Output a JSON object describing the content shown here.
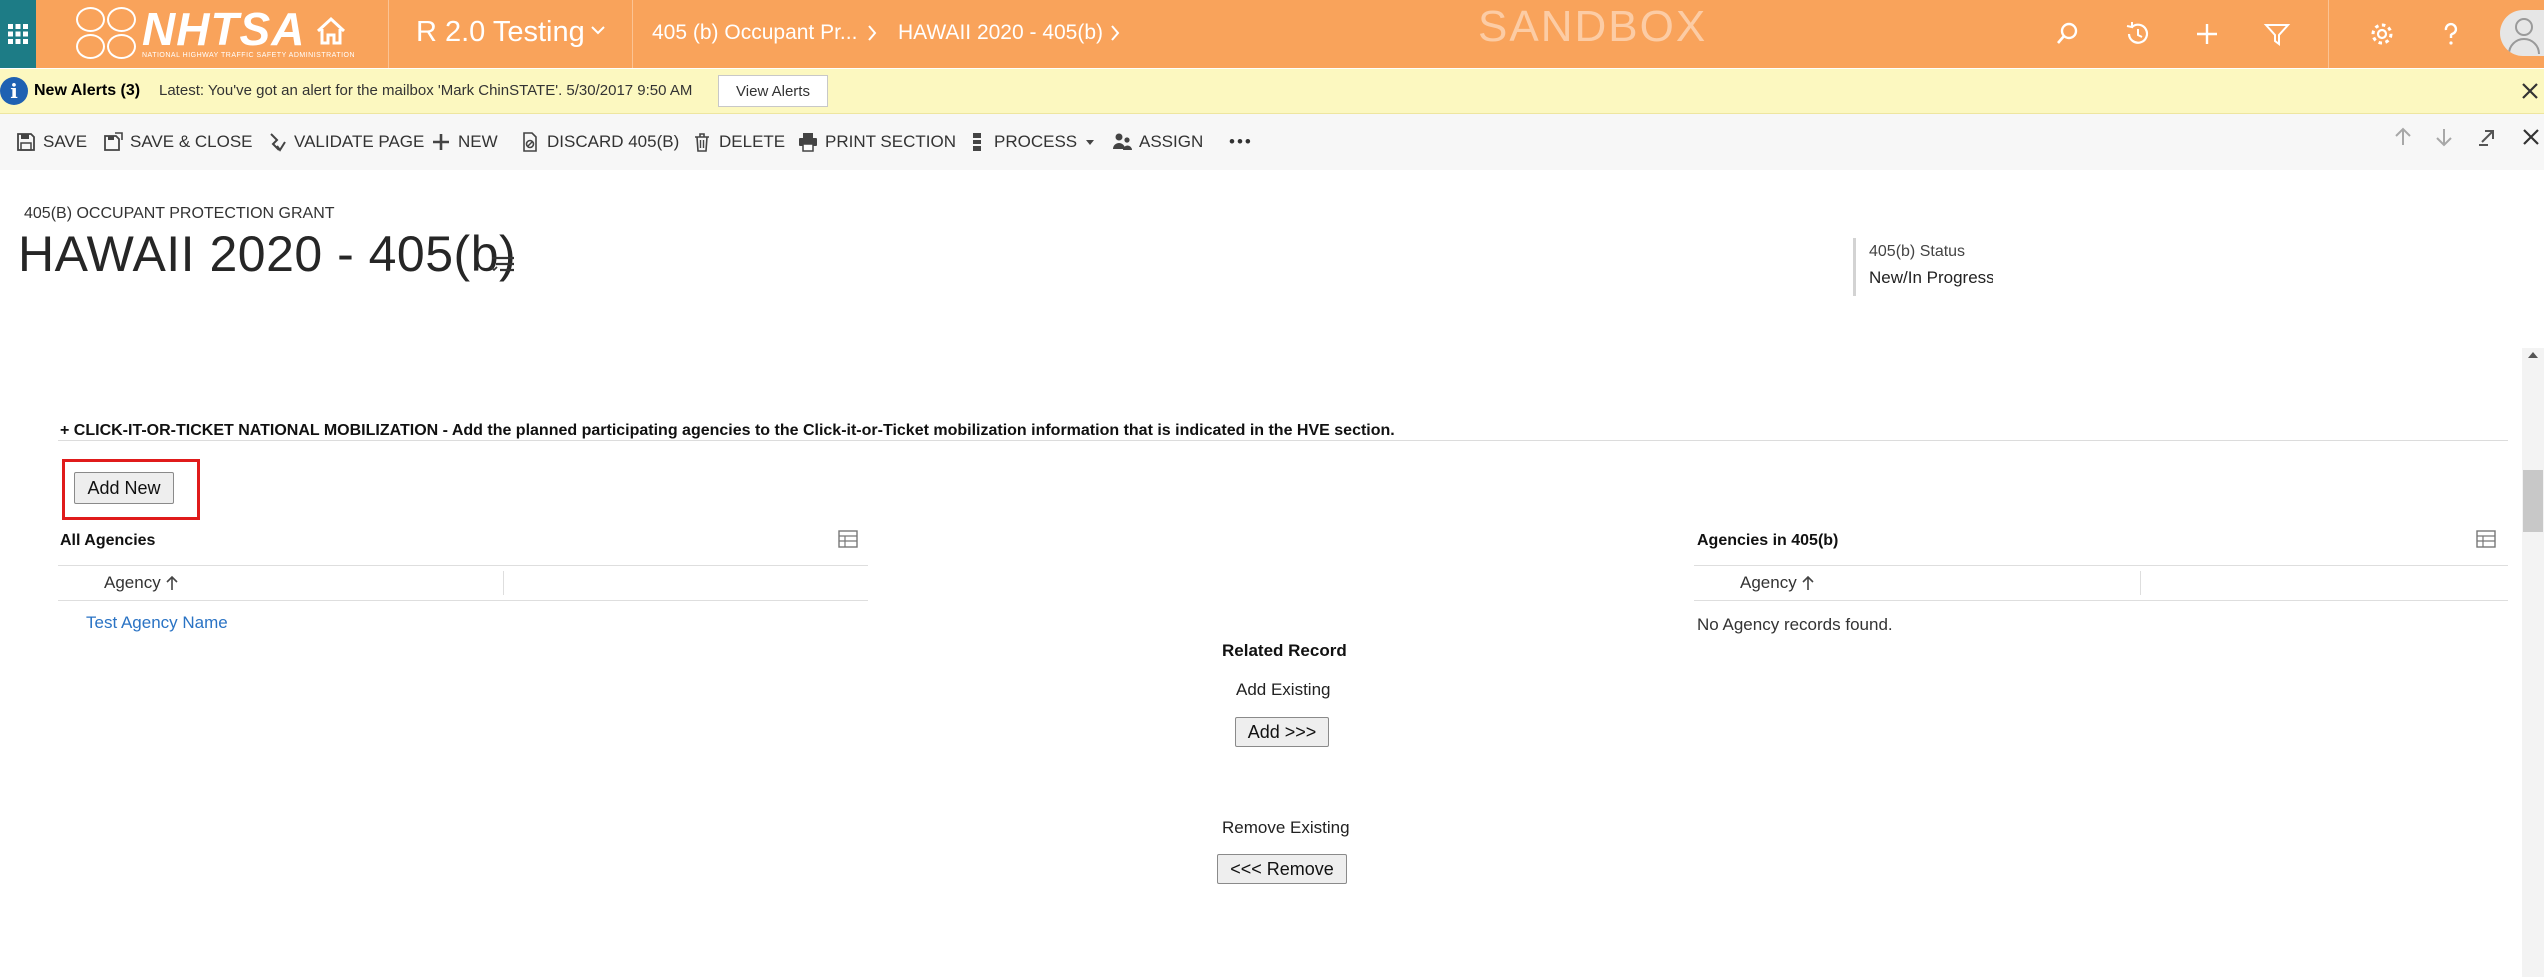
{
  "colors": {
    "topbar_bg": "#f9a35b",
    "waffle_bg": "#1d7c86",
    "alert_bg": "#fcf8c0",
    "link": "#2a73c4",
    "highlight_border": "#e01b1b"
  },
  "topnav": {
    "logo_text": "NHTSA",
    "logo_subtext": "NATIONAL HIGHWAY TRAFFIC SAFETY ADMINISTRATION",
    "app_title": "R 2.0 Testing",
    "breadcrumbs": [
      "405 (b) Occupant Pr...",
      "HAWAII 2020 - 405(b)"
    ],
    "watermark": "SANDBOX",
    "icons": [
      "waffle-icon",
      "home-icon",
      "chevron-down-icon",
      "search-icon",
      "history-icon",
      "plus-icon",
      "filter-icon",
      "gear-icon",
      "help-icon",
      "user-avatar-icon"
    ]
  },
  "alerts": {
    "count_label": "New Alerts (3)",
    "message": "Latest: You've got an alert for the mailbox 'Mark ChinSTATE'. 5/30/2017 9:50 AM",
    "view_label": "View Alerts"
  },
  "commands": {
    "save": "SAVE",
    "save_close": "SAVE & CLOSE",
    "validate": "VALIDATE PAGE",
    "new": "NEW",
    "discard": "DISCARD 405(B)",
    "delete": "DELETE",
    "print": "PRINT SECTION",
    "process": "PROCESS",
    "assign": "ASSIGN",
    "more": "•••"
  },
  "header": {
    "entity_type": "405(B) OCCUPANT PROTECTION GRANT",
    "title": "HAWAII 2020 - 405(b)",
    "status_label": "405(b) Status",
    "status_value": "New/In Progress"
  },
  "section": {
    "heading": "+ CLICK-IT-OR-TICKET NATIONAL MOBILIZATION - Add the planned participating agencies to the Click-it-or-Ticket mobilization information that is indicated in the HVE section.",
    "add_new_label": "Add New"
  },
  "all_agencies": {
    "title": "All Agencies",
    "column": "Agency",
    "rows": [
      "Test Agency Name"
    ]
  },
  "agencies_405b": {
    "title": "Agencies in 405(b)",
    "column": "Agency",
    "empty_message": "No Agency records found."
  },
  "related": {
    "title": "Related Record",
    "add_existing_label": "Add Existing",
    "add_button": "Add >>>",
    "remove_existing_label": "Remove Existing",
    "remove_button": "<<< Remove"
  }
}
